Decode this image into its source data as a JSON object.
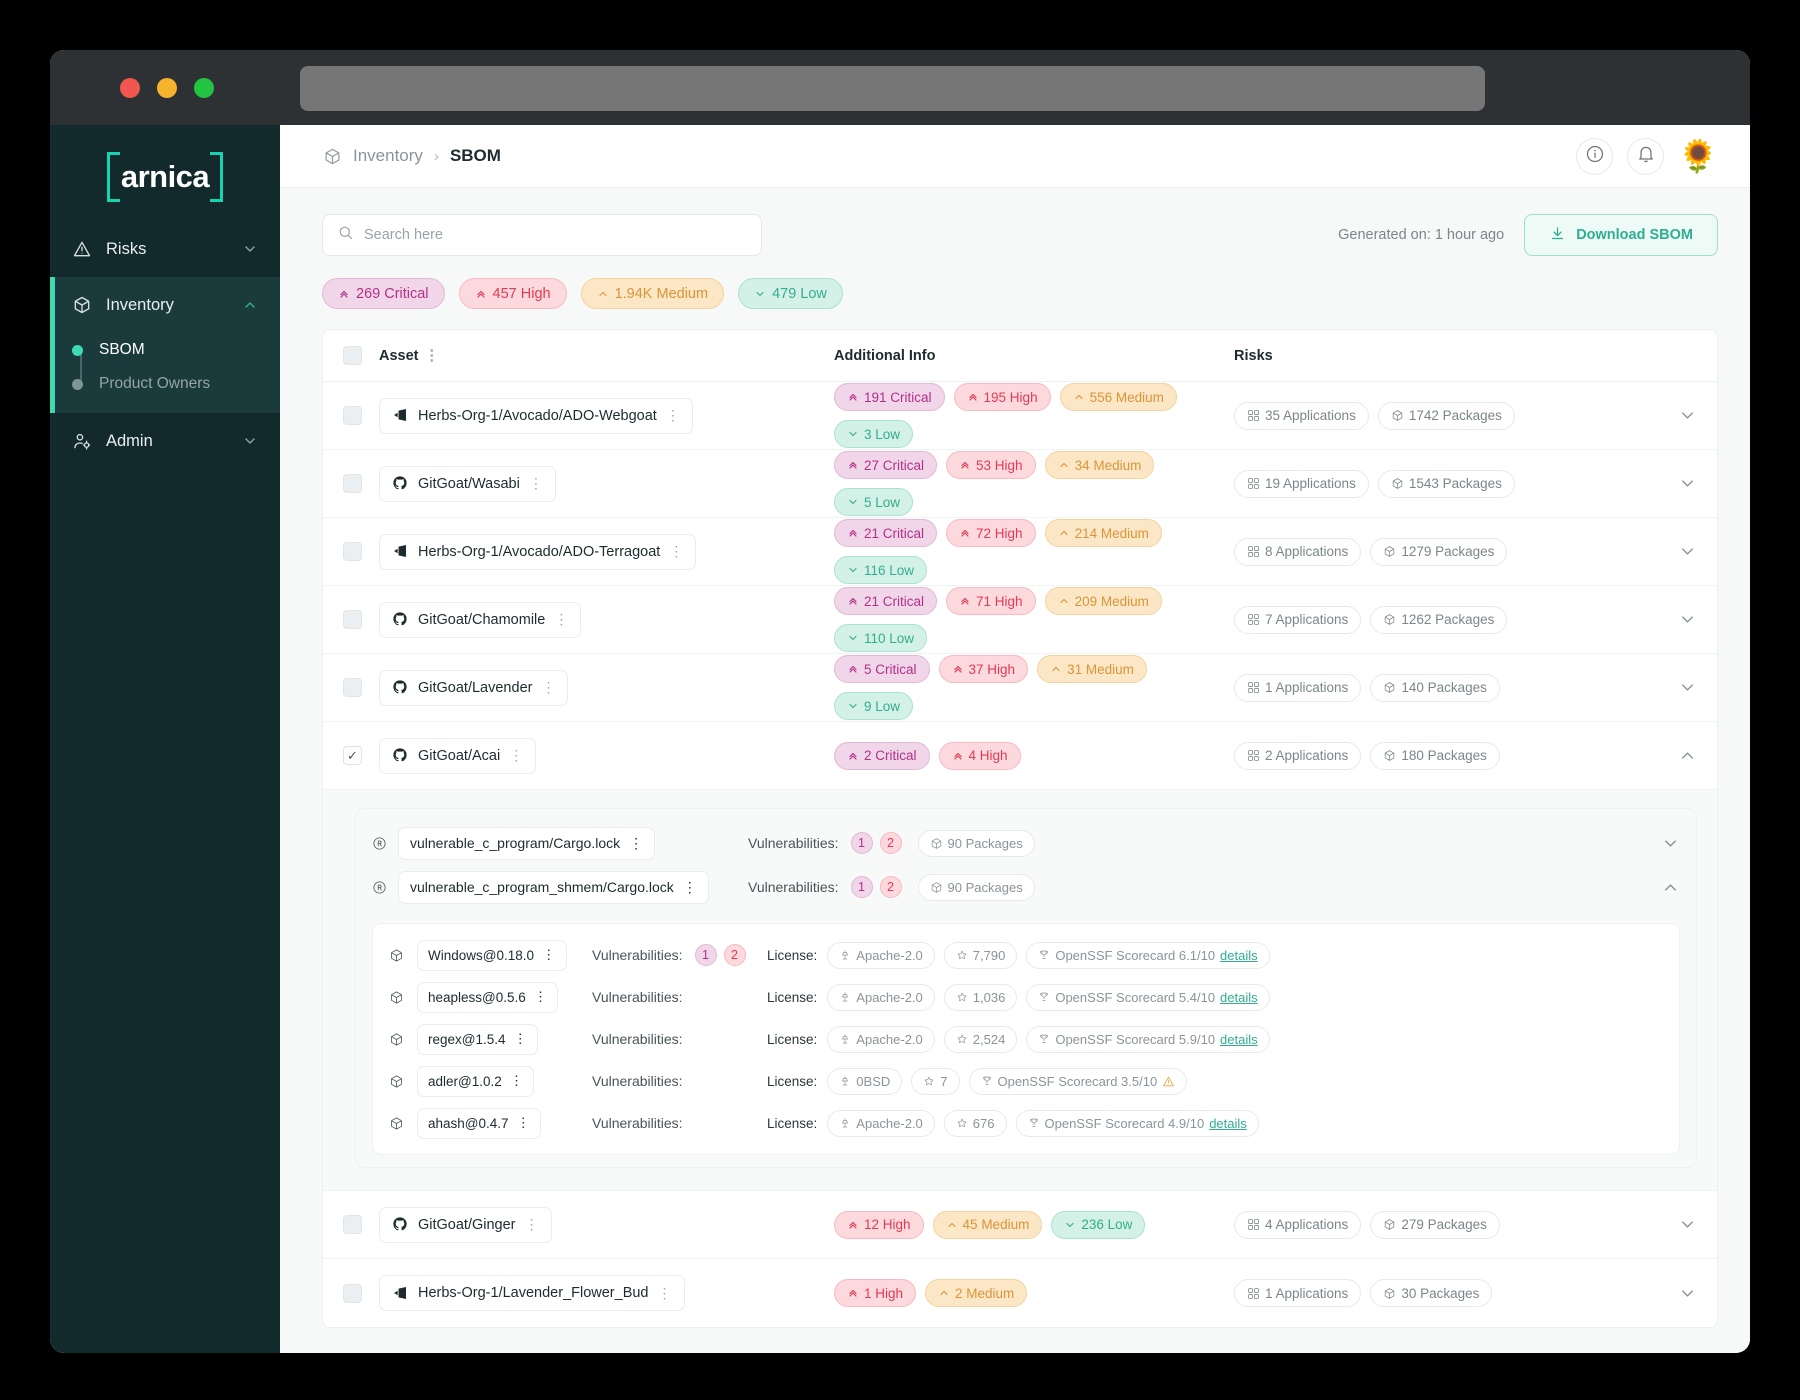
{
  "window": {
    "traffic_lights": [
      "close",
      "minimize",
      "maximize"
    ],
    "url_value": ""
  },
  "sidebar": {
    "logo_text": "arnica",
    "items": [
      {
        "label": "Risks",
        "icon": "warning-triangle-icon",
        "expanded": false
      },
      {
        "label": "Inventory",
        "icon": "cube-icon",
        "expanded": true,
        "children": [
          {
            "label": "SBOM",
            "active": true
          },
          {
            "label": "Product Owners",
            "active": false
          }
        ]
      },
      {
        "label": "Admin",
        "icon": "user-gear-icon",
        "expanded": false
      }
    ]
  },
  "header": {
    "breadcrumb": {
      "parent": "Inventory",
      "separator": "›",
      "current": "SBOM"
    },
    "actions": [
      {
        "name": "info-icon",
        "glyph": "i"
      },
      {
        "name": "bell-icon",
        "glyph": "bell"
      }
    ],
    "avatar": "🌻"
  },
  "toolbar": {
    "search_placeholder": "Search here",
    "search_value": "",
    "generated_on": "Generated on: 1 hour ago",
    "download_label": "Download SBOM"
  },
  "summary_chips": [
    {
      "label": "269 Critical",
      "severity": "critical"
    },
    {
      "label": "457 High",
      "severity": "high"
    },
    {
      "label": "1.94K Medium",
      "severity": "medium"
    },
    {
      "label": "479 Low",
      "severity": "low"
    }
  ],
  "table": {
    "headers": {
      "asset": "Asset",
      "additional_info": "Additional Info",
      "risks": "Risks"
    },
    "rows": [
      {
        "checked": false,
        "expanded": false,
        "source": "azure",
        "asset": "Herbs-Org-1/Avocado/ADO-Webgoat",
        "severities": [
          {
            "label": "191 Critical",
            "severity": "critical"
          },
          {
            "label": "195 High",
            "severity": "high"
          },
          {
            "label": "556 Medium",
            "severity": "medium"
          },
          {
            "label": "3 Low",
            "severity": "low"
          }
        ],
        "risks": [
          {
            "label": "35 Applications",
            "icon": "apps-icon"
          },
          {
            "label": "1742 Packages",
            "icon": "package-icon"
          }
        ]
      },
      {
        "checked": false,
        "expanded": false,
        "source": "github",
        "asset": "GitGoat/Wasabi",
        "severities": [
          {
            "label": "27 Critical",
            "severity": "critical"
          },
          {
            "label": "53 High",
            "severity": "high"
          },
          {
            "label": "34 Medium",
            "severity": "medium"
          },
          {
            "label": "5 Low",
            "severity": "low"
          }
        ],
        "risks": [
          {
            "label": "19 Applications",
            "icon": "apps-icon"
          },
          {
            "label": "1543 Packages",
            "icon": "package-icon"
          }
        ]
      },
      {
        "checked": false,
        "expanded": false,
        "source": "azure",
        "asset": "Herbs-Org-1/Avocado/ADO-Terragoat",
        "severities": [
          {
            "label": "21 Critical",
            "severity": "critical"
          },
          {
            "label": "72 High",
            "severity": "high"
          },
          {
            "label": "214 Medium",
            "severity": "medium"
          },
          {
            "label": "116 Low",
            "severity": "low"
          }
        ],
        "risks": [
          {
            "label": "8 Applications",
            "icon": "apps-icon"
          },
          {
            "label": "1279 Packages",
            "icon": "package-icon"
          }
        ]
      },
      {
        "checked": false,
        "expanded": false,
        "source": "github",
        "asset": "GitGoat/Chamomile",
        "severities": [
          {
            "label": "21 Critical",
            "severity": "critical"
          },
          {
            "label": "71 High",
            "severity": "high"
          },
          {
            "label": "209 Medium",
            "severity": "medium"
          },
          {
            "label": "110 Low",
            "severity": "low"
          }
        ],
        "risks": [
          {
            "label": "7 Applications",
            "icon": "apps-icon"
          },
          {
            "label": "1262 Packages",
            "icon": "package-icon"
          }
        ]
      },
      {
        "checked": false,
        "expanded": false,
        "source": "github",
        "asset": "GitGoat/Lavender",
        "severities": [
          {
            "label": "5 Critical",
            "severity": "critical"
          },
          {
            "label": "37 High",
            "severity": "high"
          },
          {
            "label": "31 Medium",
            "severity": "medium"
          },
          {
            "label": "9 Low",
            "severity": "low"
          }
        ],
        "risks": [
          {
            "label": "1 Applications",
            "icon": "apps-icon"
          },
          {
            "label": "140 Packages",
            "icon": "package-icon"
          }
        ]
      },
      {
        "checked": true,
        "expanded": true,
        "source": "github",
        "asset": "GitGoat/Acai",
        "severities": [
          {
            "label": "2 Critical",
            "severity": "critical"
          },
          {
            "label": "4 High",
            "severity": "high"
          }
        ],
        "risks": [
          {
            "label": "2 Applications",
            "icon": "apps-icon"
          },
          {
            "label": "180 Packages",
            "icon": "package-icon"
          }
        ]
      },
      {
        "checked": false,
        "expanded": false,
        "source": "github",
        "asset": "GitGoat/Ginger",
        "severities": [
          {
            "label": "12 High",
            "severity": "high"
          },
          {
            "label": "45 Medium",
            "severity": "medium"
          },
          {
            "label": "236 Low",
            "severity": "low"
          }
        ],
        "risks": [
          {
            "label": "4 Applications",
            "icon": "apps-icon"
          },
          {
            "label": "279 Packages",
            "icon": "package-icon"
          }
        ]
      },
      {
        "checked": false,
        "expanded": false,
        "source": "azure",
        "asset": "Herbs-Org-1/Lavender_Flower_Bud",
        "severities": [
          {
            "label": "1 High",
            "severity": "high"
          },
          {
            "label": "2 Medium",
            "severity": "medium"
          }
        ],
        "risks": [
          {
            "label": "1 Applications",
            "icon": "apps-icon"
          },
          {
            "label": "30 Packages",
            "icon": "package-icon"
          }
        ]
      }
    ],
    "expanded_detail": {
      "manifests": [
        {
          "name": "vulnerable_c_program/Cargo.lock",
          "vuln_label": "Vulnerabilities:",
          "vuln_counts": [
            {
              "value": "1",
              "severity": "critical"
            },
            {
              "value": "2",
              "severity": "high"
            }
          ],
          "packages_badge": "90 Packages",
          "expanded": false
        },
        {
          "name": "vulnerable_c_program_shmem/Cargo.lock",
          "vuln_label": "Vulnerabilities:",
          "vuln_counts": [
            {
              "value": "1",
              "severity": "critical"
            },
            {
              "value": "2",
              "severity": "high"
            }
          ],
          "packages_badge": "90 Packages",
          "expanded": true
        }
      ],
      "packages": [
        {
          "name": "Windows@0.18.0",
          "vuln_label": "Vulnerabilities:",
          "vuln_counts": [
            {
              "value": "1",
              "severity": "critical"
            },
            {
              "value": "2",
              "severity": "high"
            }
          ],
          "license_label": "License:",
          "license": "Apache-2.0",
          "stars": "7,790",
          "scorecard": "OpenSSF Scorecard 6.1/10",
          "details_label": "details",
          "warning": false
        },
        {
          "name": "heapless@0.5.6",
          "vuln_label": "Vulnerabilities:",
          "vuln_counts": [],
          "license_label": "License:",
          "license": "Apache-2.0",
          "stars": "1,036",
          "scorecard": "OpenSSF Scorecard 5.4/10",
          "details_label": "details",
          "warning": false
        },
        {
          "name": "regex@1.5.4",
          "vuln_label": "Vulnerabilities:",
          "vuln_counts": [],
          "license_label": "License:",
          "license": "Apache-2.0",
          "stars": "2,524",
          "scorecard": "OpenSSF Scorecard 5.9/10",
          "details_label": "details",
          "warning": false
        },
        {
          "name": "adler@1.0.2",
          "vuln_label": "Vulnerabilities:",
          "vuln_counts": [],
          "license_label": "License:",
          "license": "0BSD",
          "stars": "7",
          "scorecard": "OpenSSF Scorecard 3.5/10",
          "details_label": "",
          "warning": true
        },
        {
          "name": "ahash@0.4.7",
          "vuln_label": "Vulnerabilities:",
          "vuln_counts": [],
          "license_label": "License:",
          "license": "Apache-2.0",
          "stars": "676",
          "scorecard": "OpenSSF Scorecard 4.9/10",
          "details_label": "details",
          "warning": false
        }
      ]
    }
  },
  "colors": {
    "brand_teal": "#17d4b1",
    "sidebar_bg": "#122a2c",
    "critical": "#b2308a",
    "high": "#e43a53",
    "medium": "#d9953a",
    "low": "#34ad8c"
  }
}
